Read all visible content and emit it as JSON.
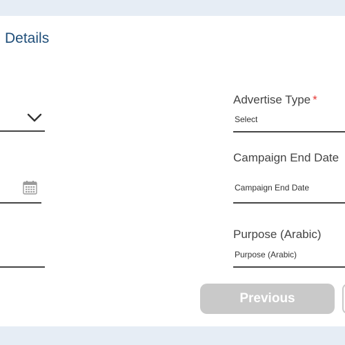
{
  "section": {
    "title": "Details"
  },
  "fields": {
    "advertise_type": {
      "label": "Advertise Type",
      "required_marker": "*",
      "value": "Select"
    },
    "campaign_end_date": {
      "label": "Campaign End Date",
      "placeholder": "Campaign End Date"
    },
    "purpose_arabic": {
      "label": "Purpose (Arabic)",
      "placeholder": "Purpose (Arabic)"
    }
  },
  "icons": {
    "dropdown": "chevron-down-icon",
    "date_picker": "calendar-icon"
  },
  "buttons": {
    "previous": "Previous"
  },
  "colors": {
    "page_background": "#e6edf5",
    "title": "#1f4e79",
    "required": "#e53935",
    "button_disabled": "#c9c9c9"
  }
}
